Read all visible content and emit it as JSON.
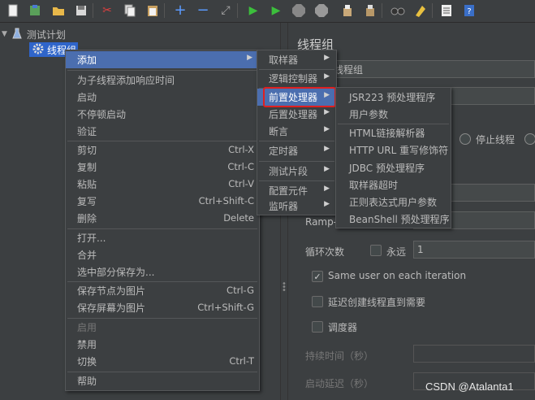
{
  "toolbar": {
    "icons": [
      "new-icon",
      "templates-icon",
      "open-icon",
      "save-icon",
      "cut-icon",
      "copy-icon",
      "paste-icon",
      "expand-icon",
      "collapse-icon",
      "toggle-icon",
      "start-icon",
      "start-no-pause-icon",
      "stop-icon",
      "shutdown-icon",
      "clear-icon",
      "clear-all-icon",
      "search-icon",
      "reset-search-icon",
      "function-helper-icon",
      "help-icon"
    ]
  },
  "tree": {
    "root": "测试计划",
    "child": "线程组"
  },
  "panel": {
    "title": "线程组",
    "name_value": "线程组",
    "stop_thread": "停止线程",
    "ramp_label": "Ramp-",
    "loop_label": "循环次数",
    "forever_label": "永远",
    "loop_value": "1",
    "same_user_label": "Same user on each iteration",
    "delay_create_label": "延迟创建线程直到需要",
    "scheduler_label": "调度器",
    "duration_label": "持续时间（秒）",
    "startup_delay_label": "启动延迟（秒）"
  },
  "context_menu": {
    "items": [
      {
        "label": "添加",
        "accel": ""
      },
      {
        "label": "为子线程添加响应时间",
        "accel": ""
      },
      {
        "label": "启动",
        "accel": ""
      },
      {
        "label": "不停顿启动",
        "accel": ""
      },
      {
        "label": "验证",
        "accel": ""
      },
      {
        "label": "剪切",
        "accel": "Ctrl-X"
      },
      {
        "label": "复制",
        "accel": "Ctrl-C"
      },
      {
        "label": "粘贴",
        "accel": "Ctrl-V"
      },
      {
        "label": "复写",
        "accel": "Ctrl+Shift-C"
      },
      {
        "label": "删除",
        "accel": "Delete"
      },
      {
        "label": "打开...",
        "accel": ""
      },
      {
        "label": "合并",
        "accel": ""
      },
      {
        "label": "选中部分保存为...",
        "accel": ""
      },
      {
        "label": "保存节点为图片",
        "accel": "Ctrl-G"
      },
      {
        "label": "保存屏幕为图片",
        "accel": "Ctrl+Shift-G"
      },
      {
        "label": "启用",
        "accel": ""
      },
      {
        "label": "禁用",
        "accel": ""
      },
      {
        "label": "切换",
        "accel": "Ctrl-T"
      },
      {
        "label": "帮助",
        "accel": ""
      }
    ]
  },
  "add_submenu": {
    "items": [
      "取样器",
      "逻辑控制器",
      "前置处理器",
      "后置处理器",
      "断言",
      "定时器",
      "测试片段",
      "配置元件",
      "监听器"
    ]
  },
  "preprocessor_submenu": {
    "items": [
      "JSR223 预处理程序",
      "用户参数",
      "HTML链接解析器",
      "HTTP URL 重写修饰符",
      "JDBC 预处理程序",
      "取样器超时",
      "正则表达式用户参数",
      "BeanShell 预处理程序"
    ]
  },
  "watermark": "CSDN @Atalanta1"
}
